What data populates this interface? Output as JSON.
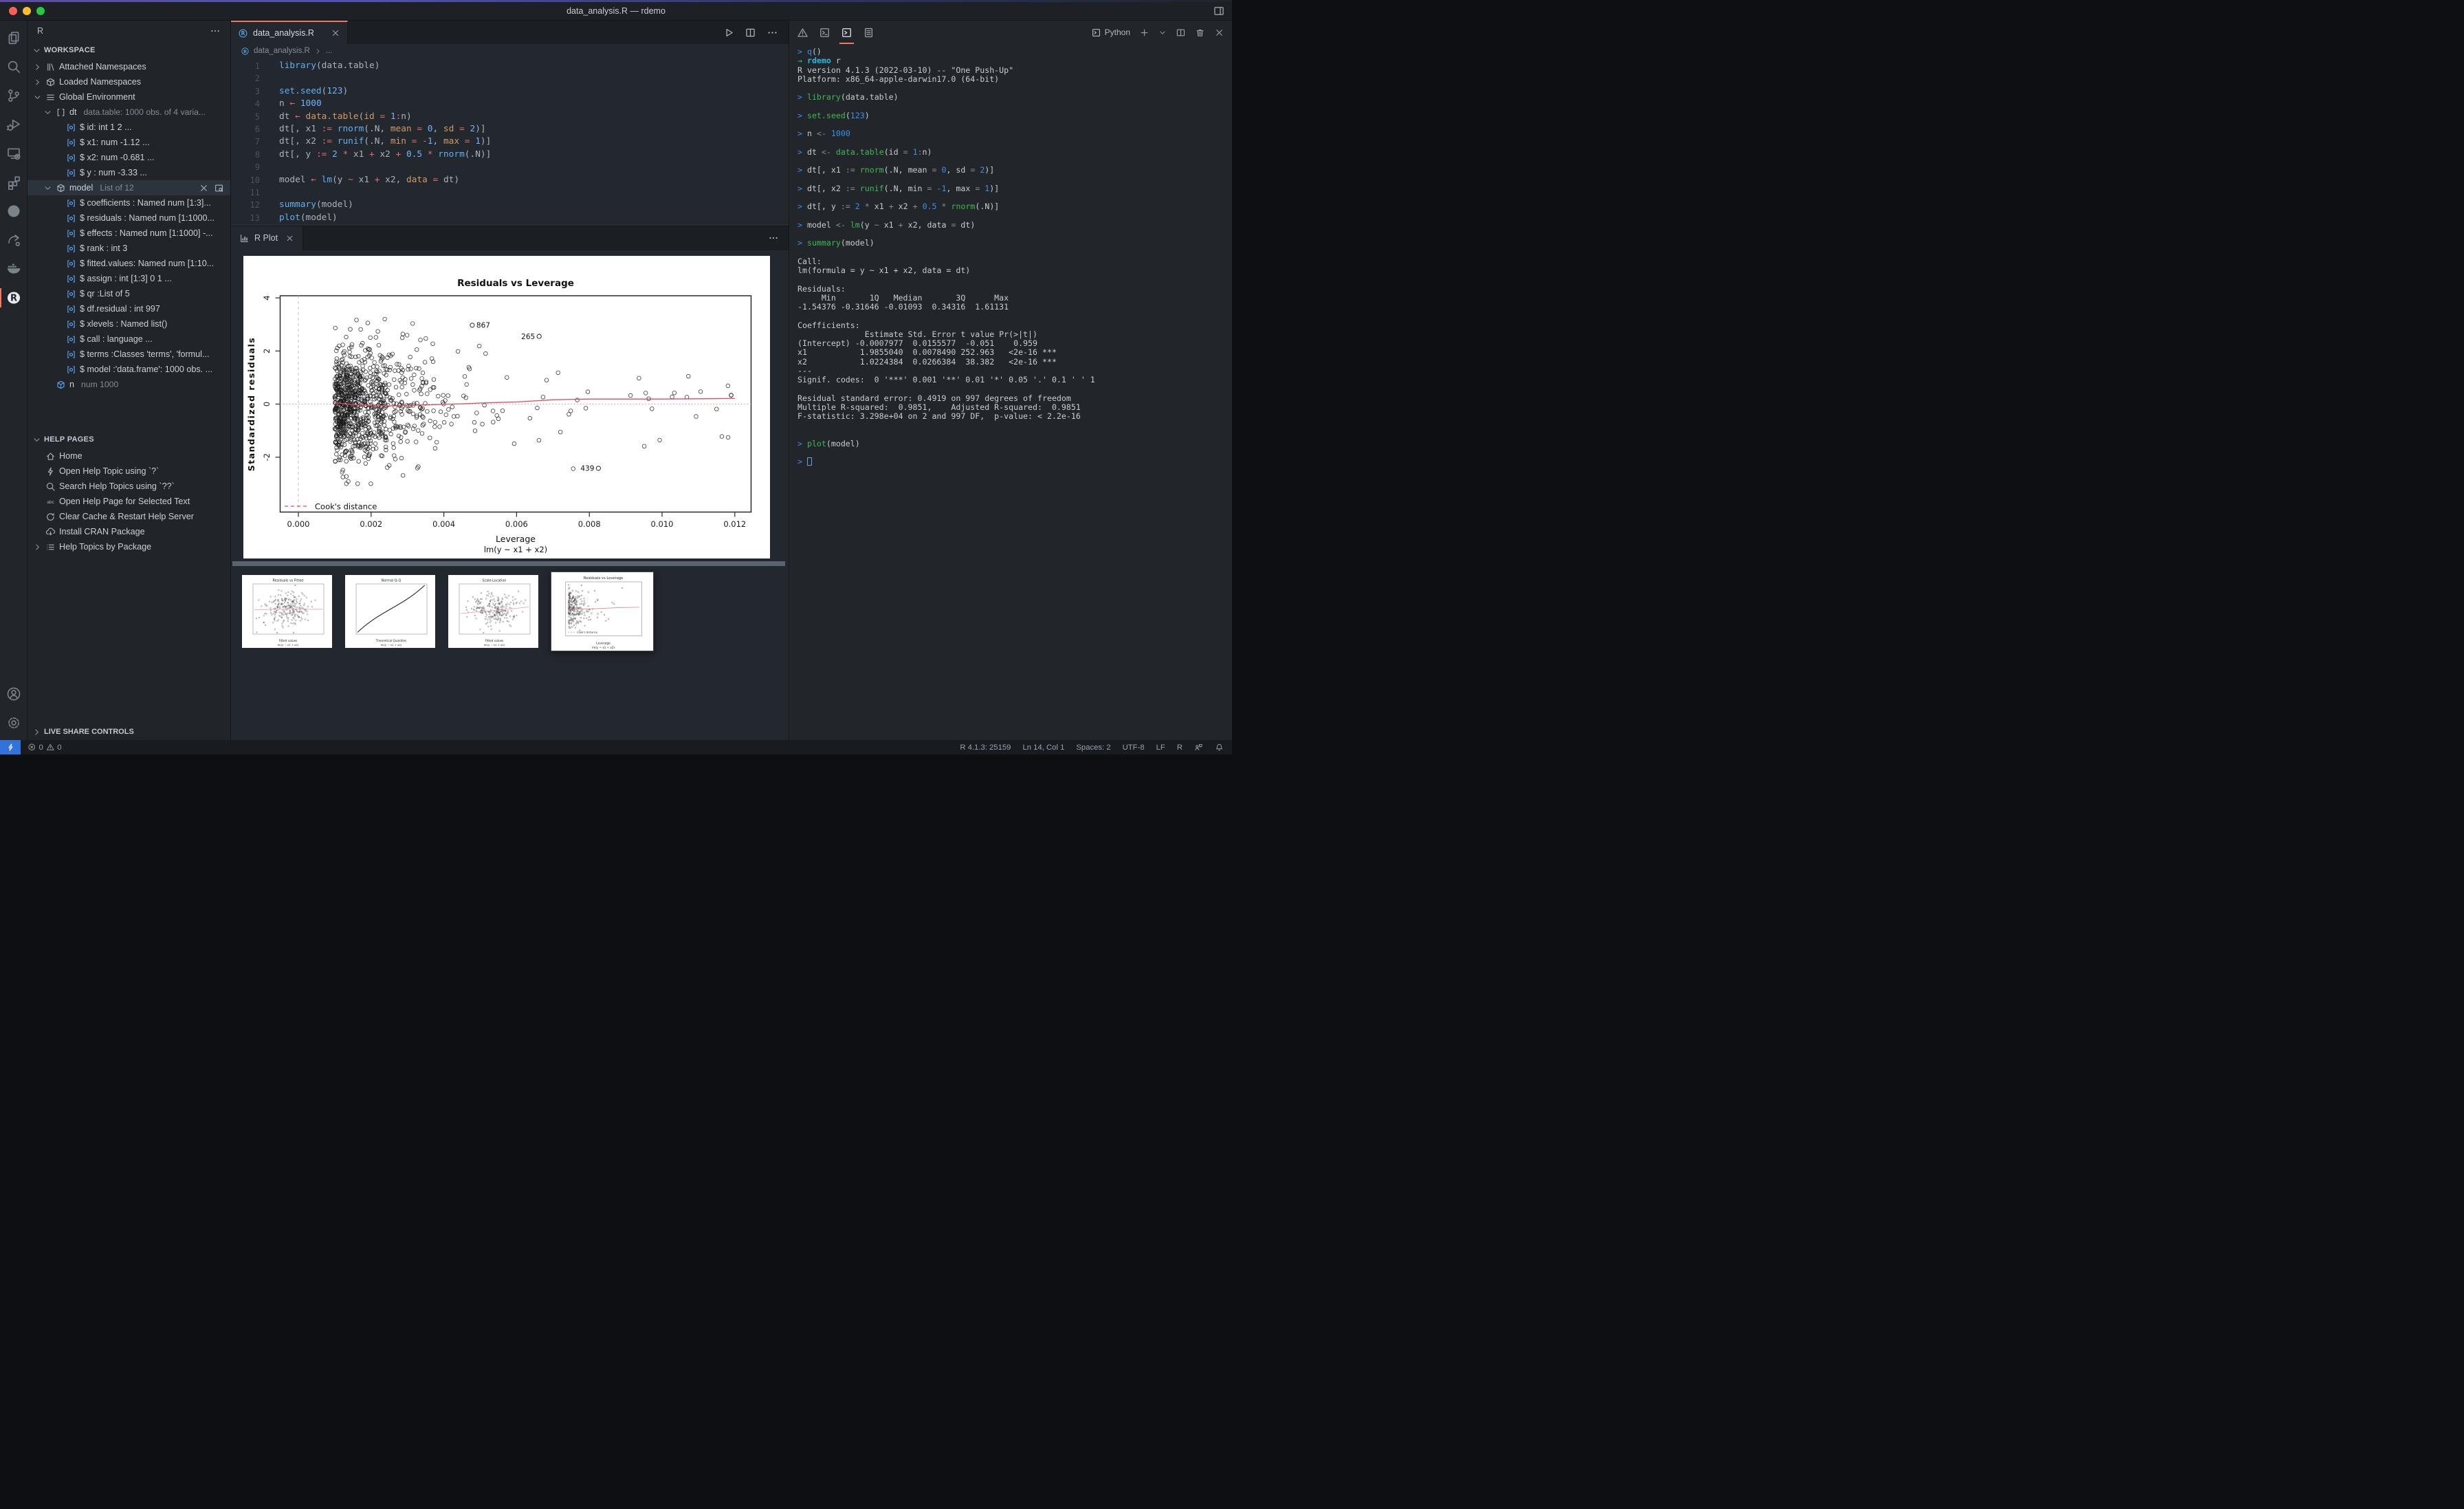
{
  "window": {
    "title": "data_analysis.R — rdemo"
  },
  "activity_bar": {
    "items": [
      {
        "name": "explorer",
        "icon": "files"
      },
      {
        "name": "search",
        "icon": "search"
      },
      {
        "name": "source-control",
        "icon": "git"
      },
      {
        "name": "run-debug",
        "icon": "debug"
      },
      {
        "name": "remote-explorer",
        "icon": "remote"
      },
      {
        "name": "extensions",
        "icon": "extensions"
      },
      {
        "name": "github",
        "icon": "github"
      },
      {
        "name": "live-share",
        "icon": "liveshare"
      },
      {
        "name": "docker",
        "icon": "docker"
      },
      {
        "name": "r",
        "icon": "rlogo",
        "active": true
      }
    ],
    "bottom": [
      {
        "name": "account",
        "icon": "account"
      },
      {
        "name": "settings",
        "icon": "gear"
      }
    ]
  },
  "sidebar": {
    "title": "R",
    "workspace": {
      "header": "WORKSPACE",
      "items": [
        {
          "chevron": "right",
          "icon": "books",
          "label": "Attached Namespaces",
          "indent": 0
        },
        {
          "chevron": "right",
          "icon": "package",
          "label": "Loaded Namespaces",
          "indent": 0
        },
        {
          "chevron": "down",
          "icon": "listicon",
          "label": "Global Environment",
          "indent": 0
        },
        {
          "chevron": "down",
          "icon": "bracket",
          "label": "dt",
          "desc": "data.table: 1000 obs. of 4 varia...",
          "indent": 1
        },
        {
          "icon": "field",
          "label": "$ id: int 1 2 ...",
          "indent": 2
        },
        {
          "icon": "field",
          "label": "$ x1: num -1.12 ...",
          "indent": 2
        },
        {
          "icon": "field",
          "label": "$ x2: num -0.681 ...",
          "indent": 2
        },
        {
          "icon": "field",
          "label": "$ y : num -3.33 ...",
          "indent": 2
        },
        {
          "chevron": "down",
          "icon": "cube",
          "label": "model",
          "desc": "List of 12",
          "indent": 1,
          "selected": true,
          "actions": [
            "close",
            "inspect"
          ]
        },
        {
          "icon": "field",
          "label": "$ coefficients : Named num [1:3]...",
          "indent": 2
        },
        {
          "icon": "field",
          "label": "$ residuals : Named num [1:1000...",
          "indent": 2
        },
        {
          "icon": "field",
          "label": "$ effects : Named num [1:1000] -...",
          "indent": 2
        },
        {
          "icon": "field",
          "label": "$ rank : int 3",
          "indent": 2
        },
        {
          "icon": "field",
          "label": "$ fitted.values: Named num [1:10...",
          "indent": 2
        },
        {
          "icon": "field",
          "label": "$ assign : int [1:3] 0 1 ...",
          "indent": 2
        },
        {
          "icon": "field",
          "label": "$ qr :List of 5",
          "indent": 2
        },
        {
          "icon": "field",
          "label": "$ df.residual : int 997",
          "indent": 2
        },
        {
          "icon": "field",
          "label": "$ xlevels : Named list()",
          "indent": 2
        },
        {
          "icon": "field",
          "label": "$ call : language ...",
          "indent": 2
        },
        {
          "icon": "field",
          "label": "$ terms :Classes 'terms', 'formul...",
          "indent": 2
        },
        {
          "icon": "field",
          "label": "$ model :'data.frame': 1000 obs. ...",
          "indent": 2
        },
        {
          "icon": "cubeblue",
          "label": "n",
          "desc": "num 1000",
          "indent": 1
        }
      ]
    },
    "help": {
      "header": "HELP PAGES",
      "items": [
        {
          "icon": "home",
          "label": "Home"
        },
        {
          "icon": "zap",
          "label": "Open Help Topic using `?`"
        },
        {
          "icon": "search",
          "label": "Search Help Topics using `??`"
        },
        {
          "icon": "abc",
          "label": "Open Help Page for Selected Text"
        },
        {
          "icon": "refresh",
          "label": "Clear Cache & Restart Help Server"
        },
        {
          "icon": "clouddl",
          "label": "Install CRAN Package"
        },
        {
          "chevron": "right",
          "icon": "listul",
          "label": "Help Topics by Package"
        }
      ]
    },
    "live_share": {
      "header": "LIVE SHARE CONTROLS"
    }
  },
  "editor": {
    "tab": {
      "label": "data_analysis.R"
    },
    "breadcrumb": "data_analysis.R",
    "breadcrumb_more": "...",
    "active_line": 14,
    "lines": [
      [
        [
          "fn",
          "library"
        ],
        [
          "w",
          "("
        ],
        [
          "w",
          "data.table"
        ],
        [
          "w",
          ")"
        ]
      ],
      [],
      [
        [
          "fn",
          "set.seed"
        ],
        [
          "w",
          "("
        ],
        [
          "num",
          "123"
        ],
        [
          "w",
          ")"
        ]
      ],
      [
        [
          "w",
          "n "
        ],
        [
          "op",
          "← "
        ],
        [
          "num",
          "1000"
        ]
      ],
      [
        [
          "w",
          "dt "
        ],
        [
          "op",
          "← "
        ],
        [
          "orange",
          "data.table"
        ],
        [
          "w",
          "("
        ],
        [
          "orange",
          "id"
        ],
        [
          "op",
          " = "
        ],
        [
          "num",
          "1"
        ],
        [
          "op",
          ":"
        ],
        [
          "w",
          "n"
        ],
        [
          "w",
          ")"
        ]
      ],
      [
        [
          "w",
          "dt[, x1 "
        ],
        [
          "op",
          ":= "
        ],
        [
          "fn",
          "rnorm"
        ],
        [
          "w",
          "(.N, "
        ],
        [
          "orange",
          "mean"
        ],
        [
          "op",
          " = "
        ],
        [
          "num",
          "0"
        ],
        [
          "w",
          ", "
        ],
        [
          "orange",
          "sd"
        ],
        [
          "op",
          " = "
        ],
        [
          "num",
          "2"
        ],
        [
          "w",
          ")]"
        ]
      ],
      [
        [
          "w",
          "dt[, x2 "
        ],
        [
          "op",
          ":= "
        ],
        [
          "fn",
          "runif"
        ],
        [
          "w",
          "(.N, "
        ],
        [
          "orange",
          "min"
        ],
        [
          "op",
          " = "
        ],
        [
          "op",
          "-"
        ],
        [
          "num",
          "1"
        ],
        [
          "w",
          ", "
        ],
        [
          "orange",
          "max"
        ],
        [
          "op",
          " = "
        ],
        [
          "num",
          "1"
        ],
        [
          "w",
          ")]"
        ]
      ],
      [
        [
          "w",
          "dt[, y "
        ],
        [
          "op",
          ":= "
        ],
        [
          "num",
          "2"
        ],
        [
          "op",
          " * "
        ],
        [
          "w",
          "x1"
        ],
        [
          "op",
          " + "
        ],
        [
          "w",
          "x2"
        ],
        [
          "op",
          " + "
        ],
        [
          "num",
          "0.5"
        ],
        [
          "op",
          " * "
        ],
        [
          "fn",
          "rnorm"
        ],
        [
          "w",
          "(.N)]"
        ]
      ],
      [],
      [
        [
          "w",
          "model "
        ],
        [
          "op",
          "← "
        ],
        [
          "fn",
          "lm"
        ],
        [
          "w",
          "(y "
        ],
        [
          "op",
          "~ "
        ],
        [
          "w",
          "x1 "
        ],
        [
          "op",
          "+ "
        ],
        [
          "w",
          "x2, "
        ],
        [
          "orange",
          "data"
        ],
        [
          "op",
          " = "
        ],
        [
          "w",
          "dt)"
        ]
      ],
      [],
      [
        [
          "fn",
          "summary"
        ],
        [
          "w",
          "(model)"
        ]
      ],
      [
        [
          "fn",
          "plot"
        ],
        [
          "w",
          "(model)"
        ]
      ],
      []
    ]
  },
  "plot_panel": {
    "tab": "R Plot",
    "chart_data": {
      "type": "scatter",
      "title": "Residuals vs Leverage",
      "xlabel": "Leverage",
      "xlabel_sub": "lm(y ~ x1 + x2)",
      "ylabel": "Standardized residuals",
      "xticks": [
        "0.000",
        "0.002",
        "0.004",
        "0.006",
        "0.008",
        "0.010",
        "0.012"
      ],
      "xtick_values": [
        0,
        0.002,
        0.004,
        0.006,
        0.008,
        0.01,
        0.012
      ],
      "yticks": [
        -2,
        0,
        2,
        4
      ],
      "xlim": [
        -0.0005,
        0.01245
      ],
      "ylim": [
        -4.15,
        4.15
      ],
      "n_points": 1000,
      "min_leverage": 0.001,
      "labeled_points": [
        {
          "label": "867",
          "x": 0.00478,
          "y": 2.97,
          "label_side": "right"
        },
        {
          "label": "265",
          "x": 0.00662,
          "y": 2.55,
          "label_side": "left"
        },
        {
          "label": "439",
          "x": 0.00825,
          "y": -2.42,
          "label_side": "left"
        }
      ],
      "smoother": [
        [
          0.00095,
          0.06
        ],
        [
          0.0015,
          -0.02
        ],
        [
          0.002,
          -0.06
        ],
        [
          0.0025,
          -0.07
        ],
        [
          0.003,
          -0.05
        ],
        [
          0.0035,
          -0.03
        ],
        [
          0.004,
          -0.01
        ],
        [
          0.0045,
          0.01
        ],
        [
          0.005,
          0.04
        ],
        [
          0.0055,
          0.06
        ],
        [
          0.006,
          0.08
        ],
        [
          0.0065,
          0.12
        ],
        [
          0.007,
          0.16
        ],
        [
          0.0075,
          0.18
        ],
        [
          0.008,
          0.19
        ],
        [
          0.009,
          0.19
        ],
        [
          0.01,
          0.19
        ],
        [
          0.011,
          0.2
        ],
        [
          0.012,
          0.21
        ]
      ],
      "reference": {
        "h_dotted_y": 0,
        "v_dashed_x": 0
      },
      "legend": {
        "label": "Cook's distance",
        "color": "#e14b5a"
      },
      "point_color": "#1a1a1a",
      "line_color": "#e14b5a"
    },
    "thumbnails": [
      {
        "title": "Residuals vs Fitted",
        "xlabel": "Fitted values",
        "sub": "lm(y ~ x1 + x2)",
        "kind": "scatter"
      },
      {
        "title": "Normal Q-Q",
        "xlabel": "Theoretical Quantiles",
        "sub": "lm(y ~ x1 + x2)",
        "kind": "qq"
      },
      {
        "title": "Scale-Location",
        "xlabel": "Fitted values",
        "sub": "lm(y ~ x1 + x2)",
        "kind": "scatter2"
      },
      {
        "title": "Residuals vs Leverage",
        "xlabel": "Leverage",
        "sub": "lm(y ~ x1 + x2)",
        "kind": "leverage",
        "selected": true
      }
    ]
  },
  "terminal": {
    "shell_label": "Python",
    "lines": [
      [
        [
          "p",
          "> "
        ],
        [
          "b",
          "q"
        ],
        [
          "t",
          "()"
        ]
      ],
      [
        [
          "a",
          "→ "
        ],
        [
          "c",
          "rdemo"
        ],
        [
          "t",
          " r"
        ]
      ],
      [
        [
          "t",
          "R version 4.1.3 (2022-03-10) -- \"One Push-Up\""
        ]
      ],
      [
        [
          "t",
          "Platform: x86_64-apple-darwin17.0 (64-bit)"
        ]
      ],
      [],
      [
        [
          "p",
          "> "
        ],
        [
          "g",
          "library"
        ],
        [
          "t",
          "(data.table)"
        ]
      ],
      [],
      [
        [
          "p",
          "> "
        ],
        [
          "g",
          "set.seed"
        ],
        [
          "t",
          "("
        ],
        [
          "n",
          "123"
        ],
        [
          "t",
          ")"
        ]
      ],
      [],
      [
        [
          "p",
          "> "
        ],
        [
          "t",
          "n "
        ],
        [
          "d",
          "<- "
        ],
        [
          "n",
          "1000"
        ]
      ],
      [],
      [
        [
          "p",
          "> "
        ],
        [
          "t",
          "dt "
        ],
        [
          "d",
          "<- "
        ],
        [
          "g",
          "data.table"
        ],
        [
          "t",
          "(id "
        ],
        [
          "d",
          "= "
        ],
        [
          "n",
          "1"
        ],
        [
          "d",
          ":"
        ],
        [
          "t",
          "n)"
        ]
      ],
      [],
      [
        [
          "p",
          "> "
        ],
        [
          "t",
          "dt[, x1 "
        ],
        [
          "d",
          ":= "
        ],
        [
          "g",
          "rnorm"
        ],
        [
          "t",
          "(.N, mean "
        ],
        [
          "d",
          "= "
        ],
        [
          "n",
          "0"
        ],
        [
          "t",
          ", sd "
        ],
        [
          "d",
          "= "
        ],
        [
          "n",
          "2"
        ],
        [
          "t",
          ")]"
        ]
      ],
      [],
      [
        [
          "p",
          "> "
        ],
        [
          "t",
          "dt[, x2 "
        ],
        [
          "d",
          ":= "
        ],
        [
          "g",
          "runif"
        ],
        [
          "t",
          "(.N, min "
        ],
        [
          "d",
          "= -"
        ],
        [
          "n",
          "1"
        ],
        [
          "t",
          ", max "
        ],
        [
          "d",
          "= "
        ],
        [
          "n",
          "1"
        ],
        [
          "t",
          ")]"
        ]
      ],
      [],
      [
        [
          "p",
          "> "
        ],
        [
          "t",
          "dt[, y "
        ],
        [
          "d",
          ":= "
        ],
        [
          "n",
          "2"
        ],
        [
          "d",
          " * "
        ],
        [
          "t",
          "x1 "
        ],
        [
          "d",
          "+ "
        ],
        [
          "t",
          "x2 "
        ],
        [
          "d",
          "+ "
        ],
        [
          "n",
          "0.5"
        ],
        [
          "d",
          " * "
        ],
        [
          "g",
          "rnorm"
        ],
        [
          "t",
          "(.N)]"
        ]
      ],
      [],
      [
        [
          "p",
          "> "
        ],
        [
          "t",
          "model "
        ],
        [
          "d",
          "<- "
        ],
        [
          "g",
          "lm"
        ],
        [
          "t",
          "(y "
        ],
        [
          "d",
          "~ "
        ],
        [
          "t",
          "x1 "
        ],
        [
          "d",
          "+ "
        ],
        [
          "t",
          "x2, data "
        ],
        [
          "d",
          "= "
        ],
        [
          "t",
          "dt)"
        ]
      ],
      [],
      [
        [
          "p",
          "> "
        ],
        [
          "g",
          "summary"
        ],
        [
          "t",
          "(model)"
        ]
      ],
      [],
      [
        [
          "t",
          "Call:"
        ]
      ],
      [
        [
          "t",
          "lm(formula = y ~ x1 + x2, data = dt)"
        ]
      ],
      [],
      [
        [
          "t",
          "Residuals:"
        ]
      ],
      [
        [
          "t",
          "     Min       1Q   Median       3Q      Max "
        ]
      ],
      [
        [
          "t",
          "-1.54376 -0.31646 -0.01093  0.34316  1.61131 "
        ]
      ],
      [],
      [
        [
          "t",
          "Coefficients:"
        ]
      ],
      [
        [
          "t",
          "              Estimate Std. Error t value Pr(>|t|)    "
        ]
      ],
      [
        [
          "t",
          "(Intercept) -0.0007977  0.0155577  -0.051    0.959    "
        ]
      ],
      [
        [
          "t",
          "x1           1.9855040  0.0078490 252.963   <2e-16 ***"
        ]
      ],
      [
        [
          "t",
          "x2           1.0224384  0.0266384  38.382   <2e-16 ***"
        ]
      ],
      [
        [
          "t",
          "---"
        ]
      ],
      [
        [
          "t",
          "Signif. codes:  0 '***' 0.001 '**' 0.01 '*' 0.05 '.' 0.1 ' ' 1"
        ]
      ],
      [],
      [
        [
          "t",
          "Residual standard error: 0.4919 on 997 degrees of freedom"
        ]
      ],
      [
        [
          "t",
          "Multiple R-squared:  0.9851,    Adjusted R-squared:  0.9851"
        ]
      ],
      [
        [
          "t",
          "F-statistic: 3.298e+04 on 2 and 997 DF,  p-value: < 2.2e-16"
        ]
      ],
      [],
      [],
      [
        [
          "p",
          "> "
        ],
        [
          "g",
          "plot"
        ],
        [
          "t",
          "(model)"
        ]
      ],
      [],
      [
        [
          "p",
          "> "
        ],
        [
          "cur",
          ""
        ]
      ]
    ]
  },
  "status_bar": {
    "errors": "0",
    "warnings": "0",
    "items": [
      "R 4.1.3: 25159",
      "Ln 14, Col 1",
      "Spaces: 2",
      "UTF-8",
      "LF",
      "R"
    ]
  }
}
